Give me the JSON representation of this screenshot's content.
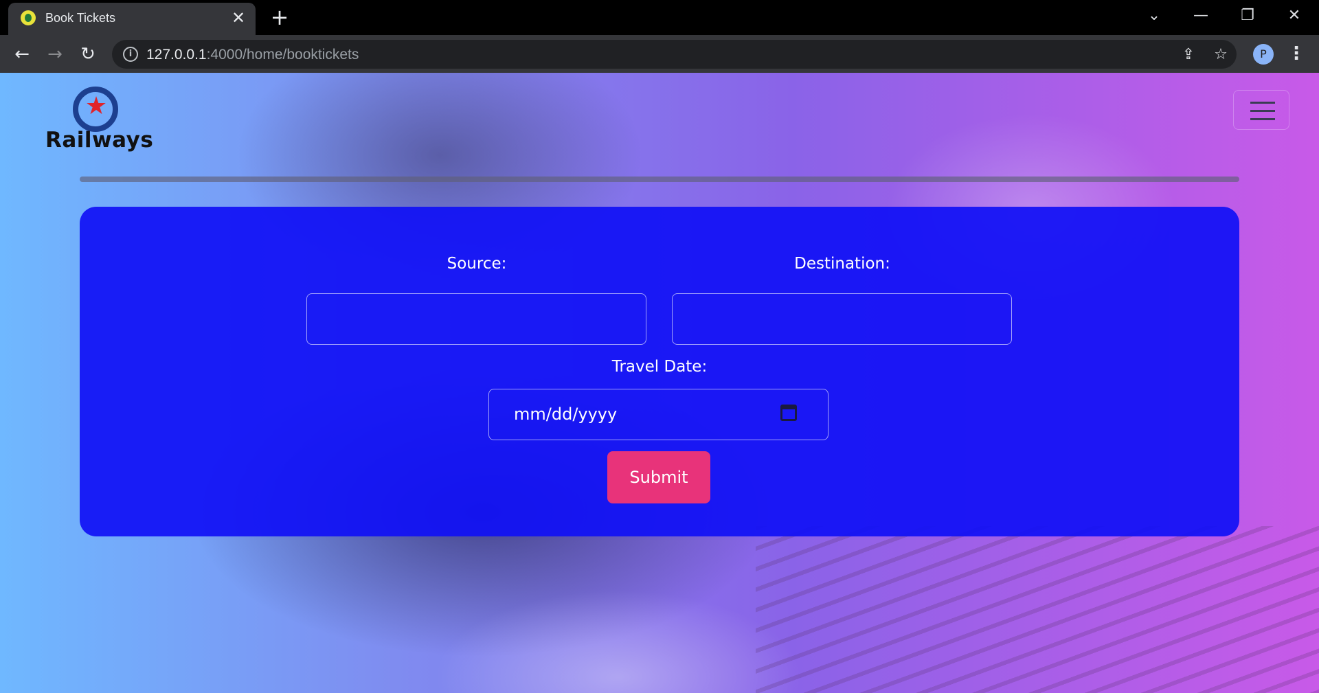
{
  "browser": {
    "tab_title": "Book Tickets",
    "tab_close": "✕",
    "new_tab": "+",
    "url_host": "127.0.0.1",
    "url_path": ":4000/home/booktickets",
    "profile_initial": "P",
    "icons": [
      "back-arrow-icon",
      "forward-arrow-icon",
      "reload-icon",
      "info-icon",
      "share-icon",
      "star-icon",
      "kebab-menu-icon"
    ]
  },
  "navbar": {
    "brand": "Railways",
    "menu_icon": "hamburger-icon"
  },
  "form": {
    "source_label": "Source:",
    "source_value": "",
    "destination_label": "Destination:",
    "destination_value": "",
    "date_label": "Travel Date:",
    "date_placeholder": "mm/dd/yyyy",
    "submit_label": "Submit"
  },
  "colors": {
    "card": "#1010f5",
    "submit": "#e8337a",
    "logo_ring": "#1d3f8f",
    "logo_star": "#e0232b"
  }
}
